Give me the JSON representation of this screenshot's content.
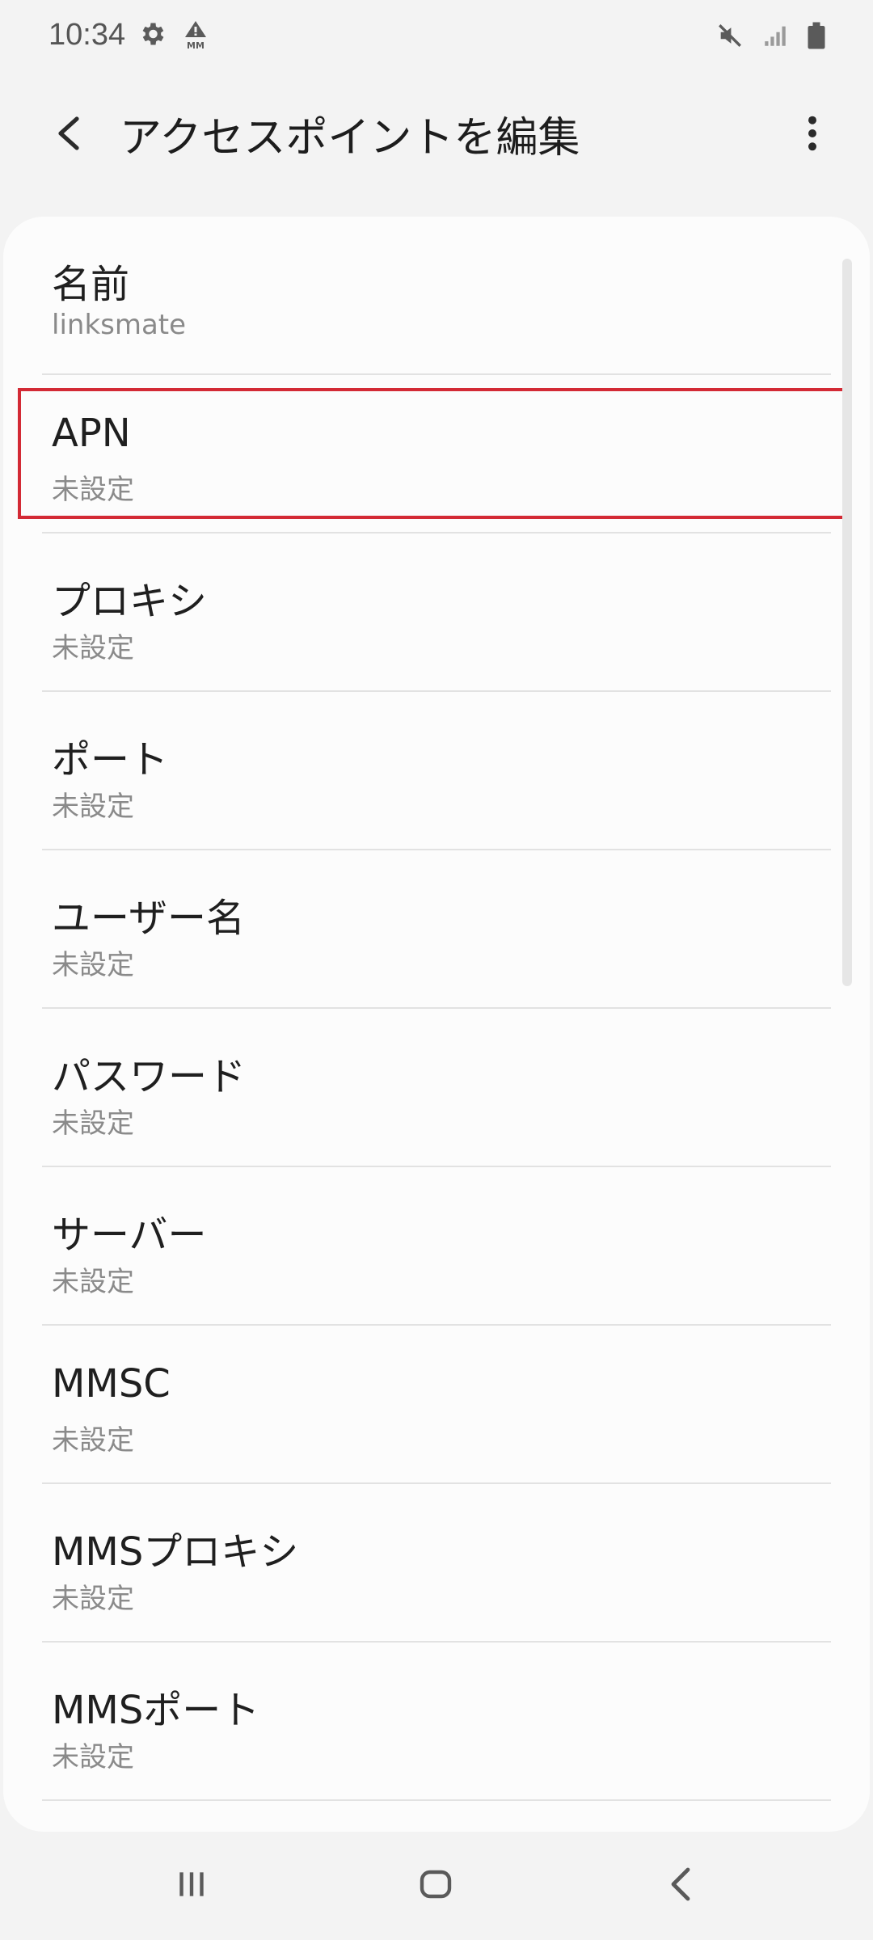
{
  "status_bar": {
    "time": "10:34",
    "left_icons": [
      "gear-icon",
      "alert-mm-icon"
    ],
    "right_icons": [
      "mute-icon",
      "signal-icon",
      "battery-icon"
    ],
    "alert_label": "MM"
  },
  "app_bar": {
    "title": "アクセスポイントを編集",
    "back_icon": "chevron-left-icon",
    "more_icon": "more-vertical-icon"
  },
  "settings": {
    "items": [
      {
        "label": "名前",
        "value": "linksmate"
      },
      {
        "label": "APN",
        "value": "未設定"
      },
      {
        "label": "プロキシ",
        "value": "未設定"
      },
      {
        "label": "ポート",
        "value": "未設定"
      },
      {
        "label": "ユーザー名",
        "value": "未設定"
      },
      {
        "label": "パスワード",
        "value": "未設定"
      },
      {
        "label": "サーバー",
        "value": "未設定"
      },
      {
        "label": "MMSC",
        "value": "未設定"
      },
      {
        "label": "MMSプロキシ",
        "value": "未設定"
      },
      {
        "label": "MMSポート",
        "value": "未設定"
      }
    ],
    "highlighted_index": 1
  },
  "nav_bar": {
    "recent_icon": "recent-apps-icon",
    "home_icon": "home-icon",
    "back_icon": "back-icon"
  },
  "colors": {
    "background": "#f3f3f3",
    "card": "#fcfcfc",
    "highlight": "#d32a35",
    "title_text": "#1f1f1f",
    "subtitle_text": "#8a8a8a"
  }
}
